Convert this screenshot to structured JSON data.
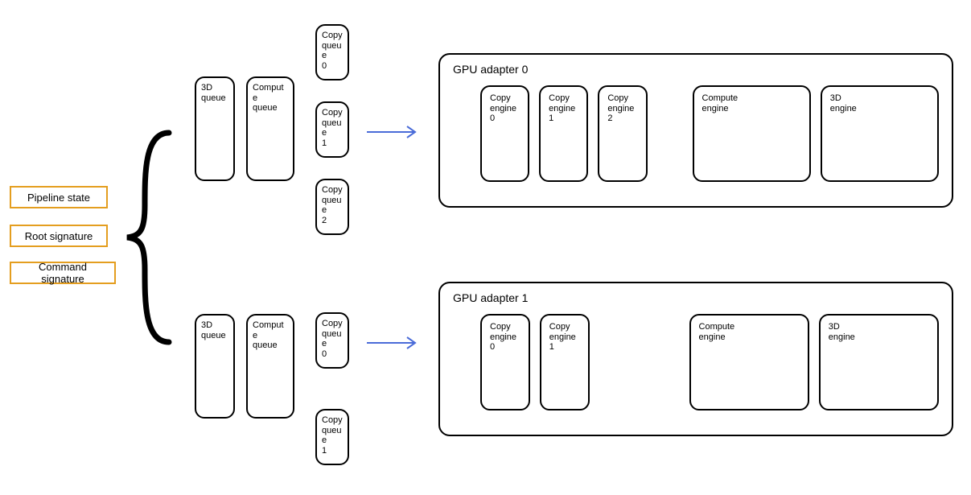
{
  "left_boxes": {
    "pipeline_state": "Pipeline state",
    "root_signature": "Root signature",
    "command_signature": "Command signature"
  },
  "queues0": {
    "q3d": "3D\nqueue",
    "compute": "Compute\nqueue",
    "copy0": "Copy\nqueue\n0",
    "copy1": "Copy\nqueue\n1",
    "copy2": "Copy\nqueue\n2"
  },
  "queues1": {
    "q3d": "3D\nqueue",
    "compute": "Compute\nqueue",
    "copy0": "Copy\nqueue\n0",
    "copy1": "Copy\nqueue\n1"
  },
  "adapter0": {
    "title": "GPU adapter 0",
    "engines": {
      "copy0": "Copy\nengine\n0",
      "copy1": "Copy\nengine\n1",
      "copy2": "Copy\nengine\n2",
      "compute": "Compute\nengine",
      "three_d": "3D\nengine"
    }
  },
  "adapter1": {
    "title": "GPU adapter 1",
    "engines": {
      "copy0": "Copy\nengine\n0",
      "copy1": "Copy\nengine\n1",
      "compute": "Compute\nengine",
      "three_d": "3D\nengine"
    }
  }
}
